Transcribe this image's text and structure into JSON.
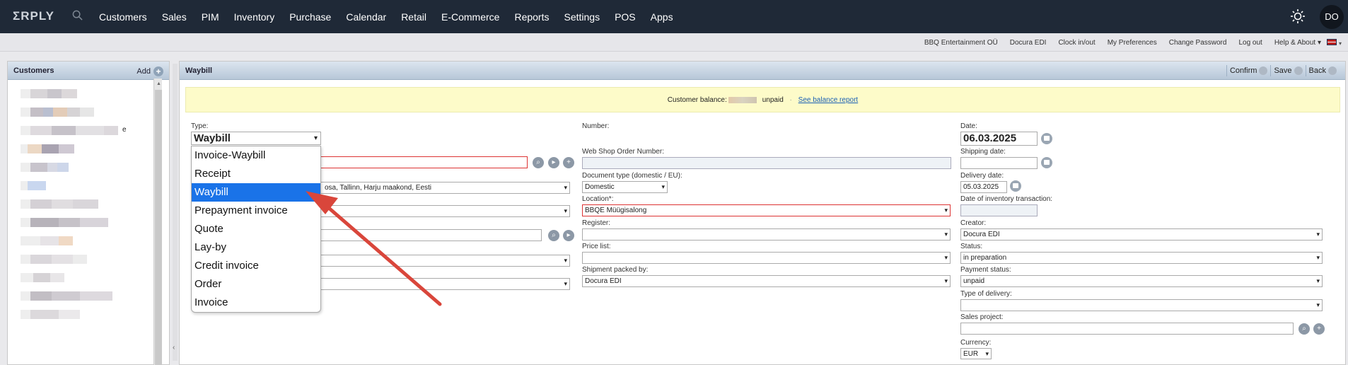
{
  "topnav": {
    "logo": "ΣRPLY",
    "items": [
      "Customers",
      "Sales",
      "PIM",
      "Inventory",
      "Purchase",
      "Calendar",
      "Retail",
      "E-Commerce",
      "Reports",
      "Settings",
      "POS",
      "Apps"
    ],
    "avatar": "DO"
  },
  "subbar": {
    "links": [
      "BBQ Entertainment OÜ",
      "Docura EDI",
      "Clock in/out",
      "My Preferences",
      "Change Password",
      "Log out",
      "Help & About ▾"
    ]
  },
  "sidebar": {
    "title": "Customers",
    "add_label": "Add",
    "partial_char": "e"
  },
  "waybill": {
    "title": "Waybill",
    "buttons": {
      "confirm": "Confirm",
      "save": "Save",
      "back": "Back"
    },
    "balance": {
      "label": "Customer balance:",
      "status": "unpaid",
      "separator": "·",
      "link": "See balance report"
    },
    "type": {
      "label": "Type:",
      "value": "Waybill"
    },
    "type_options": [
      "Invoice-Waybill",
      "Receipt",
      "Waybill",
      "Prepayment invoice",
      "Quote",
      "Lay-by",
      "Credit invoice",
      "Order",
      "Invoice"
    ],
    "selected_option_index": 2,
    "address_value": "osa, Tallinn, Harju maakond, Eesti",
    "middle": {
      "number_label": "Number:",
      "webshop_label": "Web Shop Order Number:",
      "doctype_label": "Document type (domestic / EU):",
      "doctype_value": "Domestic",
      "location_label": "Location*:",
      "location_value": "BBQE Müügisalong",
      "register_label": "Register:",
      "pricelist_label": "Price list:",
      "packed_label": "Shipment packed by:",
      "packed_value": "Docura EDI"
    },
    "right": {
      "date_label": "Date:",
      "date_value": "06.03.2025",
      "shipping_label": "Shipping date:",
      "delivery_label": "Delivery date:",
      "delivery_value": "05.03.2025",
      "inventory_label": "Date of inventory transaction:",
      "creator_label": "Creator:",
      "creator_value": "Docura EDI",
      "status_label": "Status:",
      "status_value": "in preparation",
      "payment_label": "Payment status:",
      "payment_value": "unpaid",
      "delivery_type_label": "Type of delivery:",
      "project_label": "Sales project:",
      "currency_label": "Currency:",
      "currency_value": "EUR"
    }
  },
  "colors": {
    "nav_bg": "#1f2937",
    "selected": "#1a73e8",
    "annotation_arrow": "#d9463b",
    "balance_bg": "#fdfbc9"
  }
}
